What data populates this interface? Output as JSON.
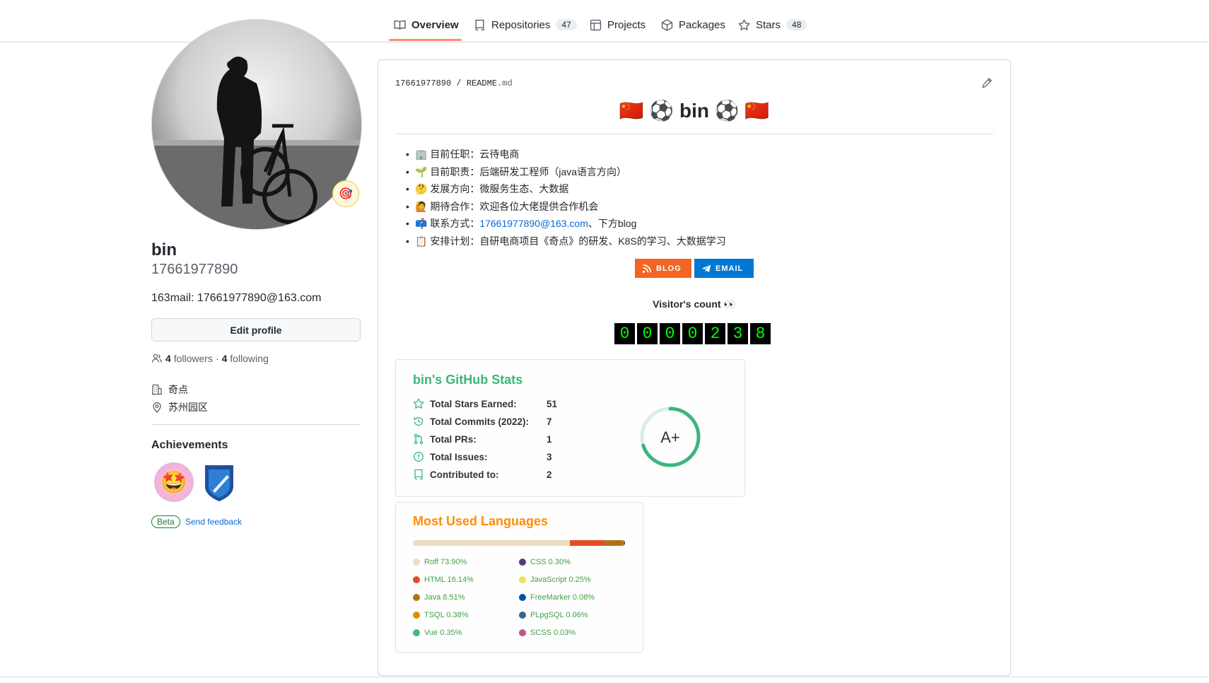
{
  "nav": {
    "tabs": [
      {
        "label": "Overview",
        "icon": "book-icon",
        "count": ""
      },
      {
        "label": "Repositories",
        "icon": "repo-icon",
        "count": "47"
      },
      {
        "label": "Projects",
        "icon": "table-icon",
        "count": ""
      },
      {
        "label": "Packages",
        "icon": "package-icon",
        "count": ""
      },
      {
        "label": "Stars",
        "icon": "star-icon",
        "count": "48"
      }
    ],
    "active_color": "#fd8c73"
  },
  "profile": {
    "name": "bin",
    "login": "17661977890",
    "bio": "163mail: 17661977890@163.com",
    "edit_label": "Edit profile",
    "followers_count": "4",
    "followers_label": "followers",
    "separator": "·",
    "following_count": "4",
    "following_label": "following",
    "company": "奇点",
    "location": "苏州园区",
    "status_emoji": "🎯"
  },
  "achievements": {
    "title": "Achievements",
    "badge_emoji": "🤩",
    "beta_label": "Beta",
    "feedback_label": "Send feedback"
  },
  "readme": {
    "path_user": "17661977890",
    "path_sep": "/",
    "path_file": "README",
    "path_ext": ".md",
    "title": "🇨🇳 ⚽ bin ⚽ 🇨🇳",
    "bullets": [
      {
        "emoji": "🏢",
        "label": "目前任职：",
        "text": "云待电商",
        "link": "",
        "tail": ""
      },
      {
        "emoji": "🌱",
        "label": "目前职责：",
        "text": "后端研发工程师（java语言方向）",
        "link": "",
        "tail": ""
      },
      {
        "emoji": "🤔",
        "label": "发展方向：",
        "text": "微服务生态、大数据",
        "link": "",
        "tail": ""
      },
      {
        "emoji": "🙋",
        "label": "期待合作：",
        "text": "欢迎各位大佬提供合作机会",
        "link": "",
        "tail": ""
      },
      {
        "emoji": "📫",
        "label": "联系方式：",
        "text": "",
        "link": "17661977890@163.com",
        "tail": "、下方blog"
      },
      {
        "emoji": "📋",
        "label": "安排计划：",
        "text": "自研电商项目《奇点》的研发、K8S的学习、大数据学习",
        "link": "",
        "tail": ""
      }
    ],
    "blog_label": "BLOG",
    "email_label": "EMAIL",
    "blog_color": "#f26522",
    "email_color": "#0078d4",
    "visitor_label": "Visitor's count 👀",
    "visitor_digits": [
      "0",
      "0",
      "0",
      "0",
      "2",
      "3",
      "8"
    ]
  },
  "stats": {
    "title": "bin's GitHub Stats",
    "rows": [
      {
        "icon": "star-icon",
        "label": "Total Stars Earned:",
        "value": "51"
      },
      {
        "icon": "history-icon",
        "label": "Total Commits (2022):",
        "value": "7"
      },
      {
        "icon": "pull-request-icon",
        "label": "Total PRs:",
        "value": "1"
      },
      {
        "icon": "issue-icon",
        "label": "Total Issues:",
        "value": "3"
      },
      {
        "icon": "repo-icon",
        "label": "Contributed to:",
        "value": "2"
      }
    ],
    "grade": "A+",
    "grade_fraction": 0.7,
    "accent": "#3cb57c"
  },
  "languages": {
    "title": "Most Used Languages",
    "items": [
      {
        "name": "Roff",
        "percent": "73.90%",
        "value": 73.9,
        "color": "#ecdebe"
      },
      {
        "name": "HTML",
        "percent": "16.14%",
        "value": 16.14,
        "color": "#e34c26"
      },
      {
        "name": "Java",
        "percent": "8.51%",
        "value": 8.51,
        "color": "#b07219"
      },
      {
        "name": "TSQL",
        "percent": "0.38%",
        "value": 0.38,
        "color": "#e38c00"
      },
      {
        "name": "Vue",
        "percent": "0.35%",
        "value": 0.35,
        "color": "#41b883"
      },
      {
        "name": "CSS",
        "percent": "0.30%",
        "value": 0.3,
        "color": "#563d7c"
      },
      {
        "name": "JavaScript",
        "percent": "0.25%",
        "value": 0.25,
        "color": "#f1e05a"
      },
      {
        "name": "FreeMarker",
        "percent": "0.08%",
        "value": 0.08,
        "color": "#0050b2"
      },
      {
        "name": "PLpgSQL",
        "percent": "0.06%",
        "value": 0.06,
        "color": "#336790"
      },
      {
        "name": "SCSS",
        "percent": "0.03%",
        "value": 0.03,
        "color": "#c6538c"
      }
    ]
  }
}
